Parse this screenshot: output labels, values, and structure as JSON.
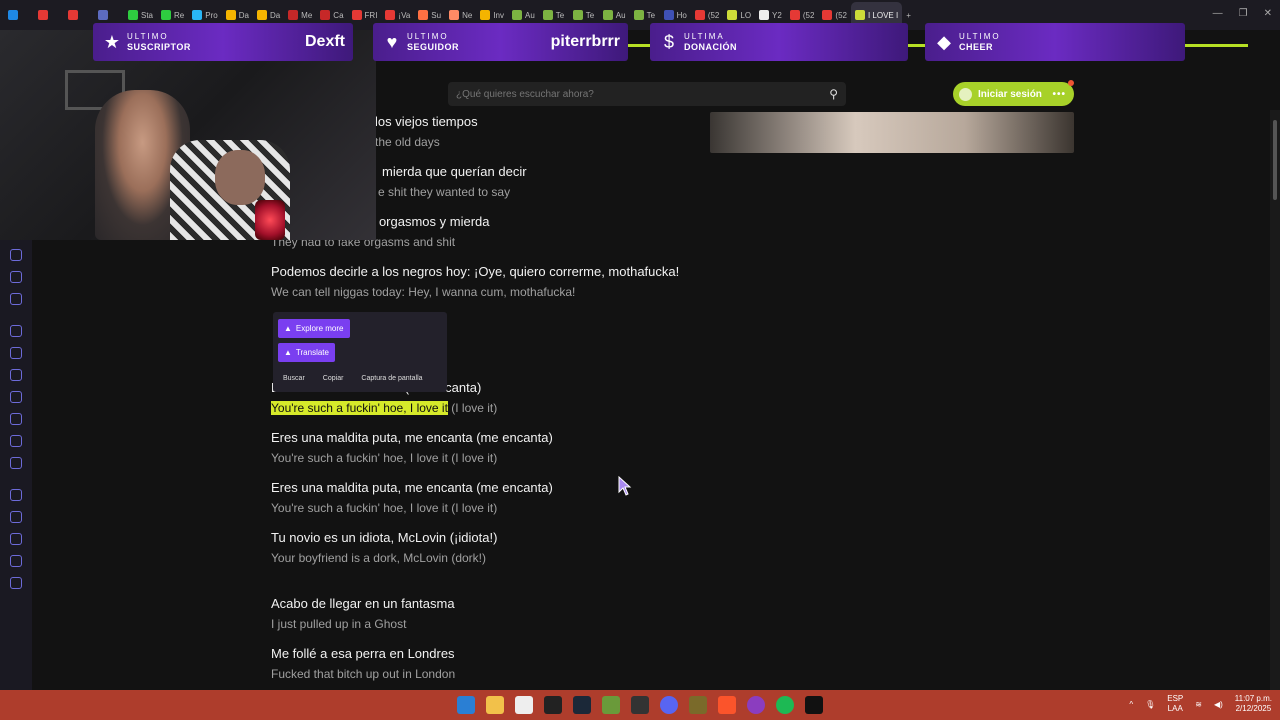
{
  "browser": {
    "tabs": [
      {
        "label": "",
        "color": "#1e88e5"
      },
      {
        "label": "",
        "color": "#e53935"
      },
      {
        "label": "",
        "color": "#e53935"
      },
      {
        "label": "",
        "color": "#5c6bc0"
      },
      {
        "label": "Sta",
        "color": "#2ecc40"
      },
      {
        "label": "Re",
        "color": "#2ecc40"
      },
      {
        "label": "Pro",
        "color": "#29b6f6"
      },
      {
        "label": "Da",
        "color": "#f4b400"
      },
      {
        "label": "Da",
        "color": "#f4b400"
      },
      {
        "label": "Me",
        "color": "#c62828"
      },
      {
        "label": "Ca",
        "color": "#c62828"
      },
      {
        "label": "FRI",
        "color": "#e53935"
      },
      {
        "label": "¡Va",
        "color": "#e53935"
      },
      {
        "label": "Su",
        "color": "#ff7043"
      },
      {
        "label": "Ne",
        "color": "#ff8a65"
      },
      {
        "label": "Inv",
        "color": "#f4b400"
      },
      {
        "label": "Au",
        "color": "#7cb342"
      },
      {
        "label": "Te",
        "color": "#7cb342"
      },
      {
        "label": "Te",
        "color": "#7cb342"
      },
      {
        "label": "Au",
        "color": "#7cb342"
      },
      {
        "label": "Te",
        "color": "#7cb342"
      },
      {
        "label": "Ho",
        "color": "#3f51b5"
      },
      {
        "label": "(52",
        "color": "#e53935"
      },
      {
        "label": "LO",
        "color": "#cddc39"
      },
      {
        "label": "Y2",
        "color": "#eeeeee"
      },
      {
        "label": "(52",
        "color": "#e53935"
      },
      {
        "label": "(52",
        "color": "#e53935"
      },
      {
        "label": "I LOVE I",
        "color": "#cddc39"
      }
    ],
    "new_tab": "+"
  },
  "alerts": [
    {
      "small": "ULTIMO",
      "label": "SUSCRIPTOR",
      "name": "Dexft",
      "icon": "star-icon"
    },
    {
      "small": "ULTIMO",
      "label": "SEGUIDOR",
      "name": "piterrbrrr",
      "icon": "heart-icon"
    },
    {
      "small": "ULTIMA",
      "label": "DONACIÓN",
      "name": "",
      "icon": "dollar-icon"
    },
    {
      "small": "ULTIMO",
      "label": "CHEER",
      "name": "",
      "icon": "diamond-icon"
    }
  ],
  "site": {
    "search_placeholder": "¿Qué quieres escuchar ahora?",
    "login_label": "Iniciar sesión",
    "more_label": "•••"
  },
  "lyrics": [
    {
      "es": "los viejos tiempos",
      "en": "the old days",
      "partial": true
    },
    {
      "es": "mierda que querían decir",
      "en": "e shit they wanted to say",
      "partial": true
    },
    {
      "es": "r orgasmos y mierda",
      "en": "They had to fake orgasms and shit",
      "partial": true
    },
    {
      "es": "Podemos decirle a los negros hoy: ¡Oye, quiero correrme, mothafucka!",
      "en": "We can tell niggas today: Hey, I wanna cum, mothafucka!"
    },
    {
      "es": "Eres una mal      enc  anta (me encanta)",
      "en_hl": "You're such a fuckin' hoe, I love it",
      "en_rest": " (I love it)"
    },
    {
      "es": "Eres una maldita puta, me encanta (me encanta)",
      "en": "You're such a fuckin' hoe, I love it (I love it)"
    },
    {
      "es": "Eres una maldita puta, me encanta (me encanta)",
      "en": "You're such a fuckin' hoe, I love it (I love it)"
    },
    {
      "es": "Tu novio es un idiota, McLovin (¡idiota!)",
      "en": "Your boyfriend is a dork, McLovin (dork!)"
    },
    {
      "es": "Acabo de llegar en un fantasma",
      "en": "I just pulled up in a Ghost"
    },
    {
      "es": "Me follé a esa perra en Londres",
      "en": "Fucked that bitch up out in London"
    }
  ],
  "popup": {
    "explore": "Explore more",
    "translate": "Translate",
    "menu": [
      "Buscar",
      "Copiar",
      "Captura de pantalla"
    ]
  },
  "taskbar": {
    "lang_top": "ESP",
    "lang_bottom": "LAA",
    "time": "11:07 p.m.",
    "date": "2/12/2025"
  }
}
